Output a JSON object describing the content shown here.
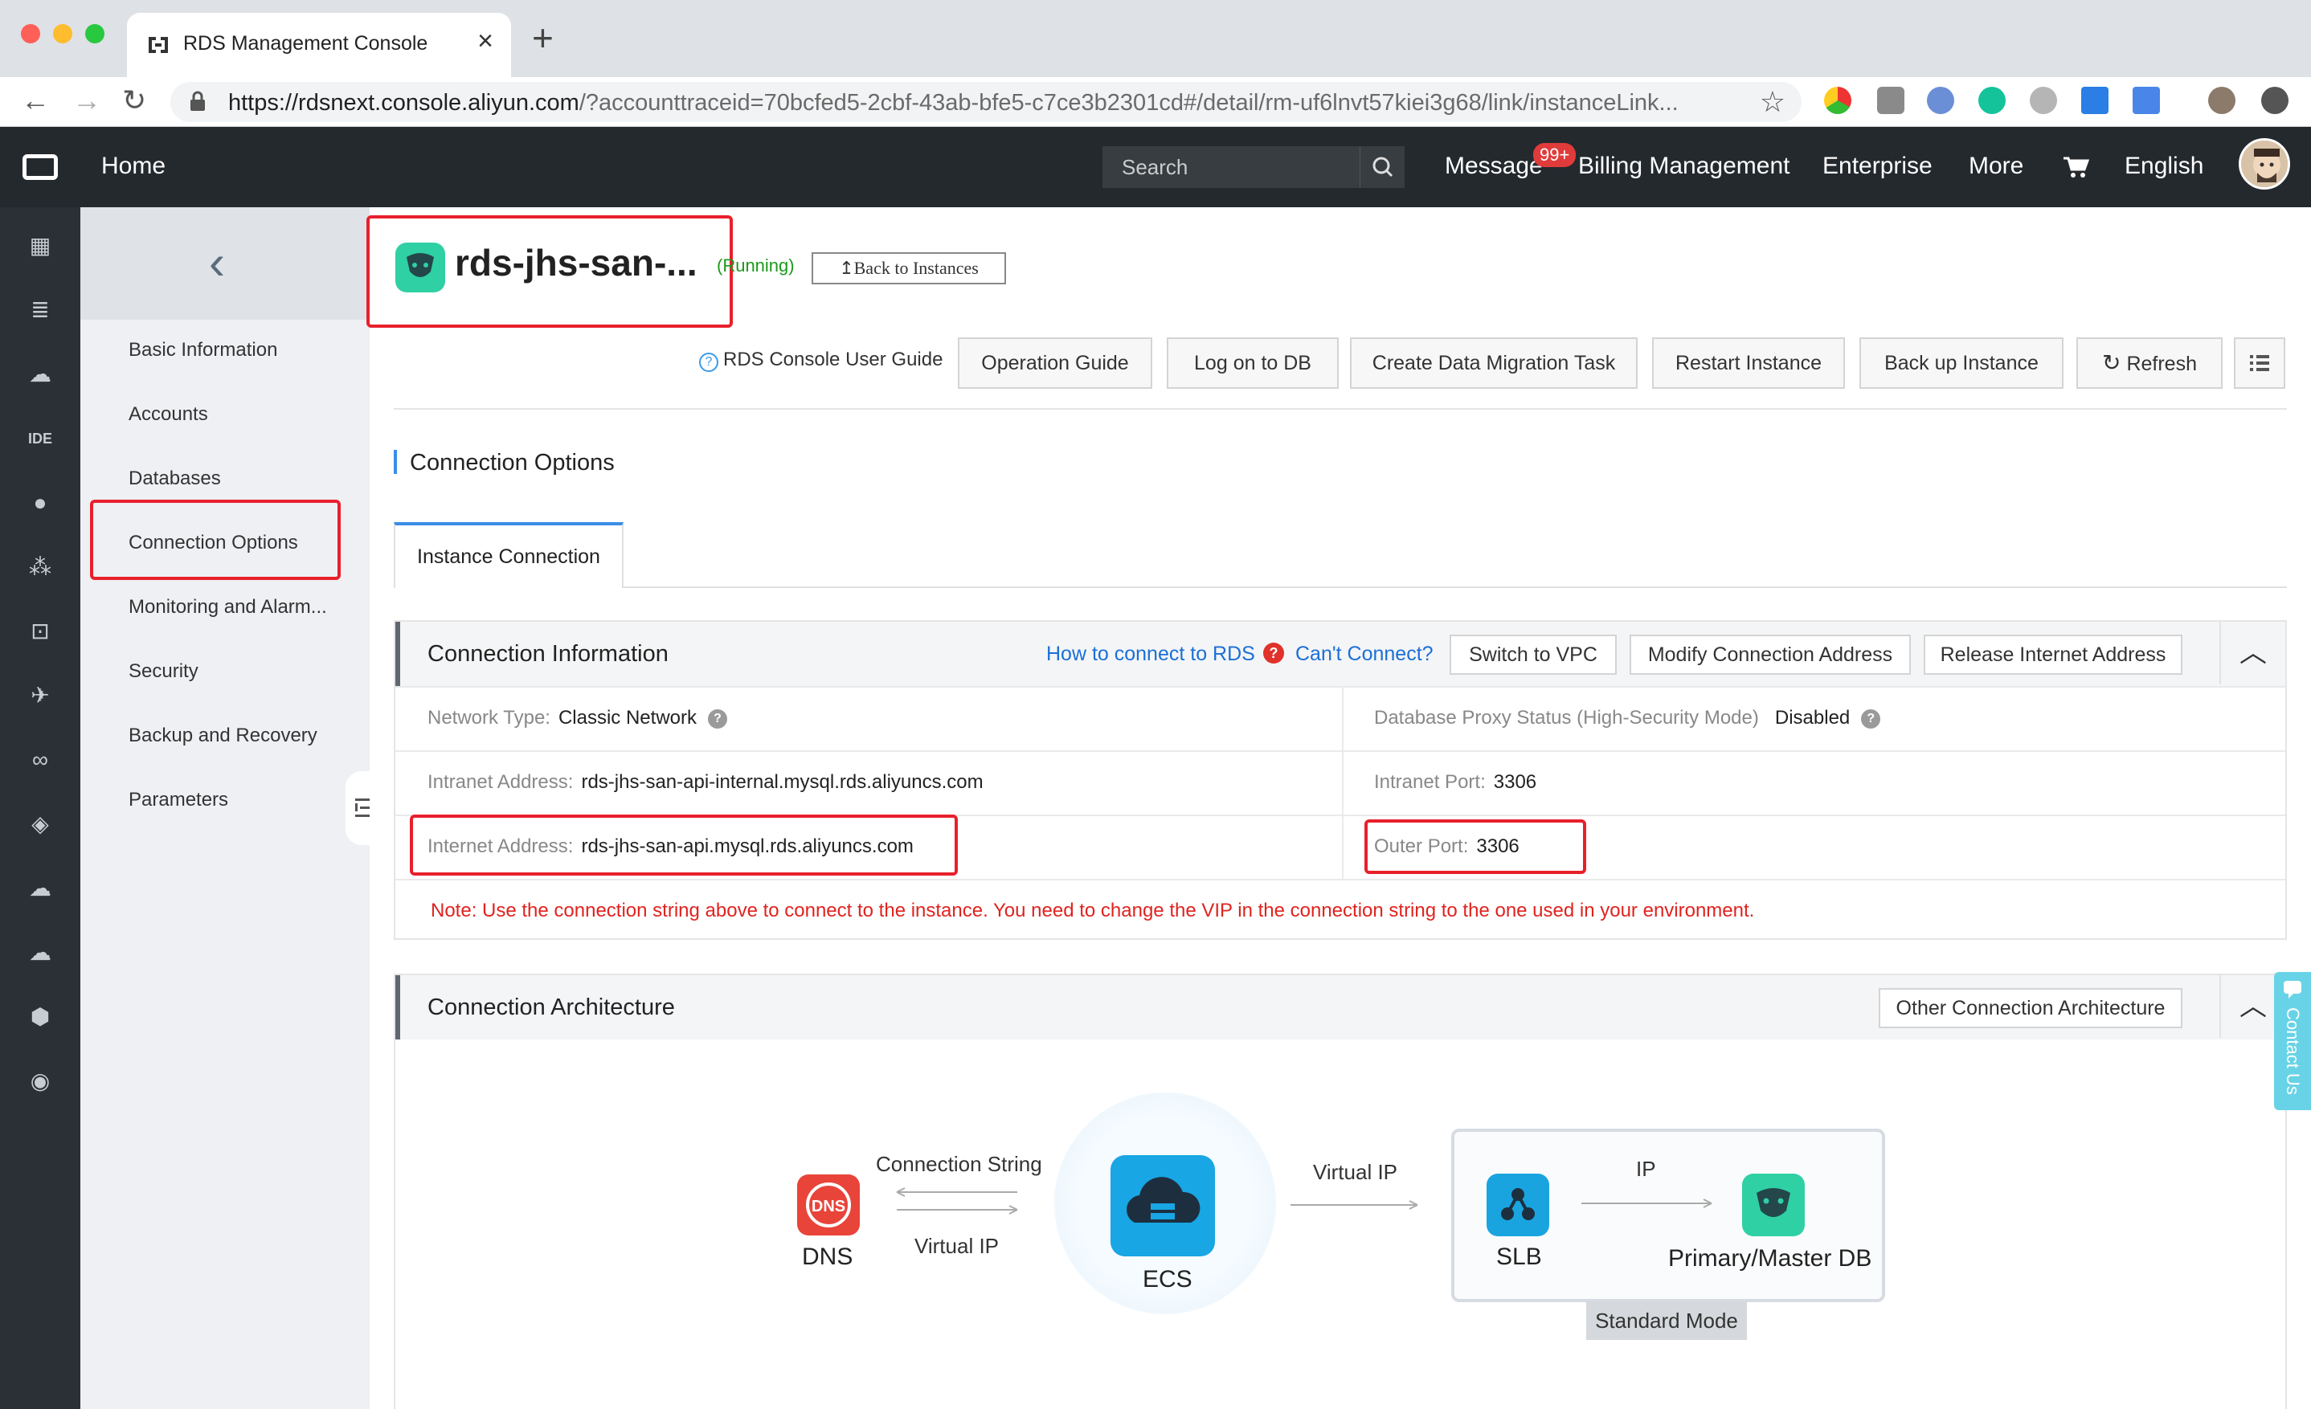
{
  "browser": {
    "tab_title": "RDS Management Console",
    "url_host": "https://rdsnext.console.aliyun.com",
    "url_path": "/?accounttraceid=70bcfed5-2cbf-43ab-bfe5-c7ce3b2301cd#/detail/rm-uf6lnvt57kiei3g68/link/instanceLink..."
  },
  "topbar": {
    "home": "Home",
    "search_placeholder": "Search",
    "message": "Message",
    "message_badge": "99+",
    "billing": "Billing Management",
    "enterprise": "Enterprise",
    "more": "More",
    "language": "English"
  },
  "sidebar": {
    "items": [
      {
        "label": "Basic Information"
      },
      {
        "label": "Accounts"
      },
      {
        "label": "Databases"
      },
      {
        "label": "Connection Options"
      },
      {
        "label": "Monitoring and Alarm..."
      },
      {
        "label": "Security"
      },
      {
        "label": "Backup and Recovery"
      },
      {
        "label": "Parameters"
      }
    ],
    "active_item": "Connection Options"
  },
  "instance": {
    "name": "rds-jhs-san-...",
    "status": "(Running)",
    "back_label": "Back to Instances"
  },
  "toolbar": {
    "guide_link": "RDS Console User Guide",
    "buttons": [
      "Operation Guide",
      "Log on to DB",
      "Create Data Migration Task",
      "Restart Instance",
      "Back up Instance",
      "Refresh"
    ]
  },
  "section": {
    "title": "Connection Options",
    "tab": "Instance Connection"
  },
  "connection_info": {
    "title": "Connection Information",
    "how_link": "How to connect to RDS",
    "cant_link": "Can't Connect?",
    "buttons": [
      "Switch to VPC",
      "Modify Connection Address",
      "Release Internet Address"
    ],
    "rows": [
      {
        "left_label": "Network Type:",
        "left_value": "Classic Network",
        "right_label": "Database Proxy Status (High-Security Mode)",
        "right_value": "Disabled"
      },
      {
        "left_label": "Intranet Address:",
        "left_value": "rds-jhs-san-api-internal.mysql.rds.aliyuncs.com",
        "right_label": "Intranet Port:",
        "right_value": "3306"
      },
      {
        "left_label": "Internet Address:",
        "left_value": "rds-jhs-san-api.mysql.rds.aliyuncs.com",
        "right_label": "Outer Port:",
        "right_value": "3306"
      }
    ],
    "note": "Note: Use the connection string above to connect to the instance. You need to change the VIP in the connection string to the one used in your environment."
  },
  "architecture": {
    "title": "Connection Architecture",
    "other_button": "Other Connection Architecture",
    "dns": "DNS",
    "dns_icon_text": "DNS",
    "connection_string": "Connection String",
    "virtual_ip_lower": "Virtual IP",
    "ecs": "ECS",
    "virtual_ip": "Virtual IP",
    "ip": "IP",
    "slb": "SLB",
    "primary_db": "Primary/Master DB",
    "standard_mode": "Standard Mode"
  },
  "contact_us": "Contact Us",
  "colors": {
    "topbar": "#24292e",
    "accent_blue": "#3a8ee6",
    "highlight_red": "#e8202c",
    "running_green": "#1a9a1a",
    "note_red": "#e0231f"
  }
}
